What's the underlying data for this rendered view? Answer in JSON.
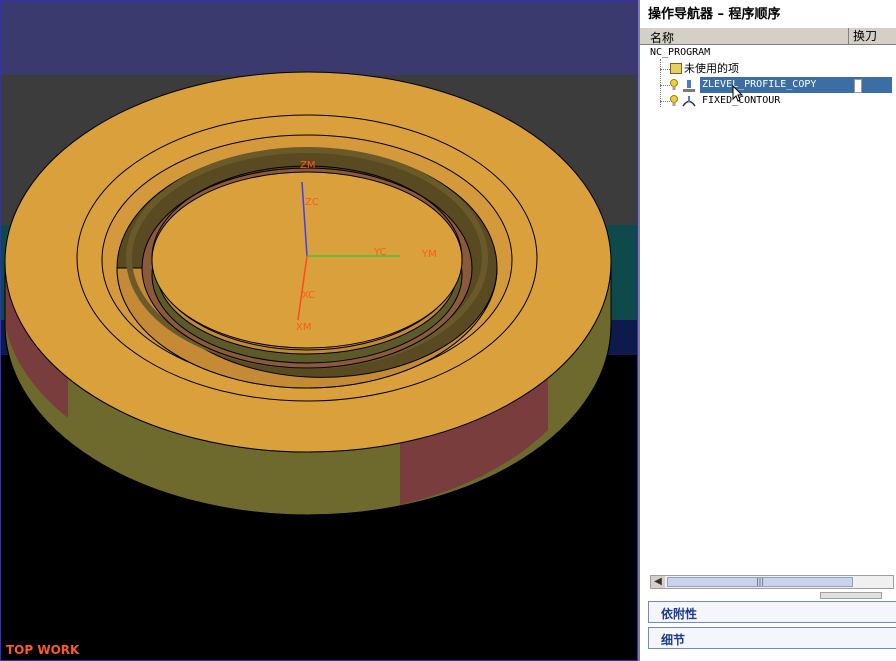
{
  "viewport": {
    "label": "TOP WORK",
    "axes": {
      "zm": "ZM",
      "zc": "ZC",
      "yc": "YC",
      "ym": "YM",
      "xc": "XC",
      "xm": "XM"
    }
  },
  "navigator": {
    "title": "操作导航器 – 程序顺序",
    "columns": {
      "name": "名称",
      "tool_change": "换刀"
    },
    "tree": {
      "root": "NC_PROGRAM",
      "unused": "未使用的项",
      "op1": "ZLEVEL_PROFILE_COPY",
      "op2": "FIXED_CONTOUR"
    },
    "scroll_glyph": "|||",
    "panels": {
      "dependencies": "依附性",
      "details": "细节"
    }
  },
  "colors": {
    "part": "#d9a03c",
    "selection": "#3a6ea5",
    "label": "#ff5a1e"
  }
}
